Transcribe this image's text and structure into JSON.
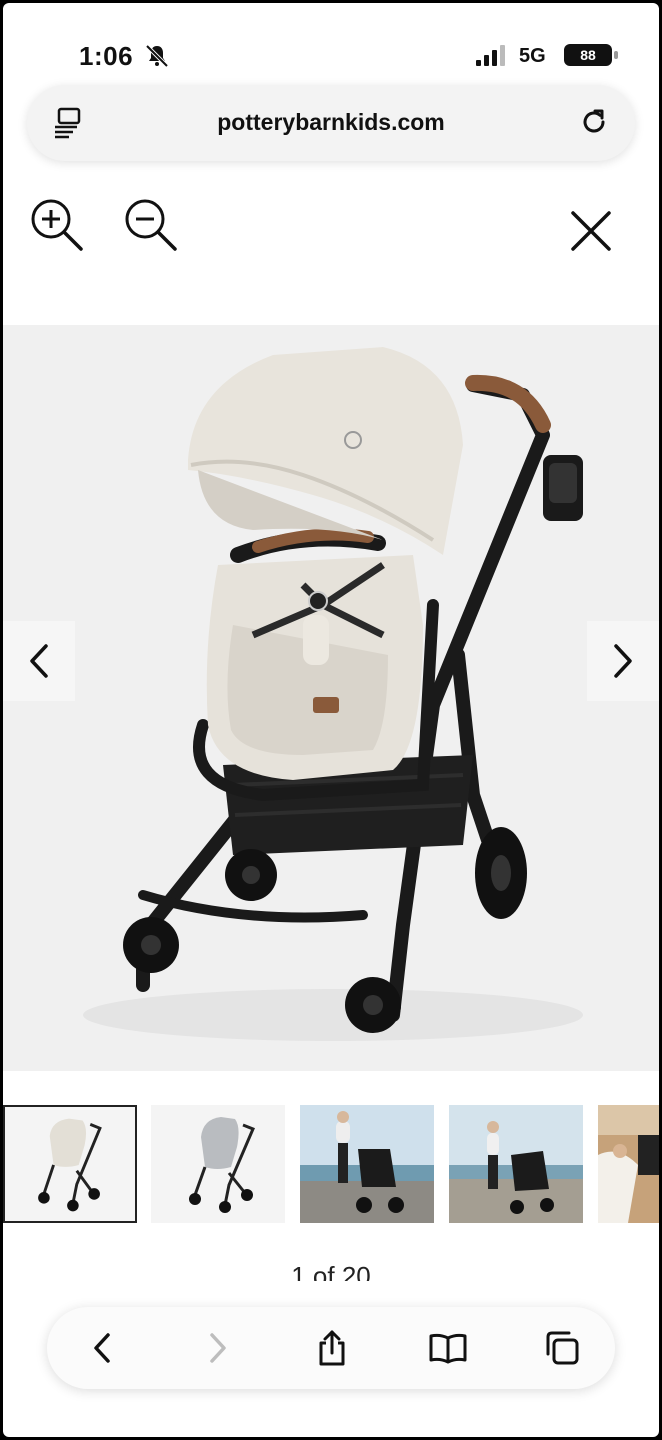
{
  "status_bar": {
    "time": "1:06",
    "network": "5G",
    "battery": "88"
  },
  "browser": {
    "url": "potterybarnkids.com"
  },
  "viewer": {
    "counter": "1 of 20",
    "thumbnails": [
      {
        "label": "stroller-light-beige"
      },
      {
        "label": "stroller-grey"
      },
      {
        "label": "woman-pushing-stroller"
      },
      {
        "label": "person-with-stroller-beach"
      },
      {
        "label": "lifestyle-photo"
      }
    ]
  },
  "colors": {
    "accent_leather": "#8a5a3a",
    "fabric": "#e6e2da",
    "frame": "#1a1a1a"
  }
}
